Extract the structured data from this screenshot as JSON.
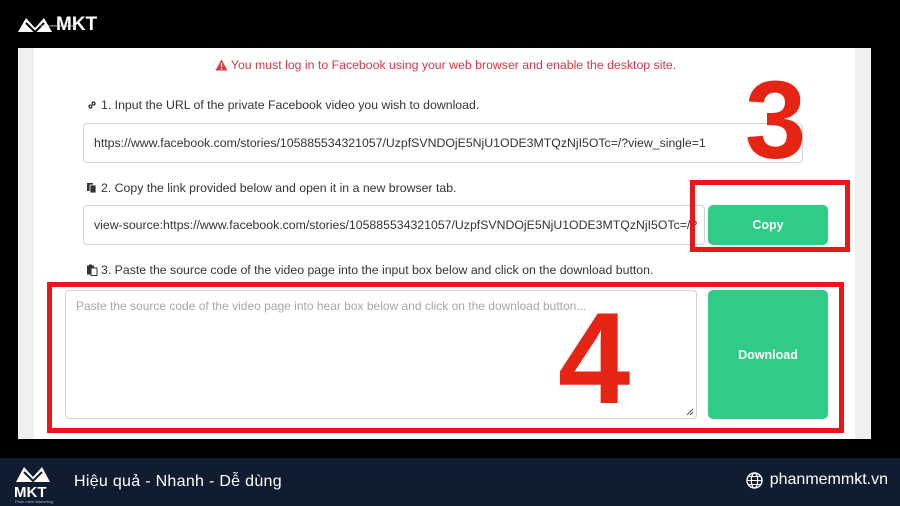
{
  "brand": {
    "name": "MKT",
    "tagline": "Phần mềm Marketing",
    "slogan": "Hiệu quả - Nhanh  - Dễ dùng",
    "website": "phanmemmkt.vn"
  },
  "alert": {
    "text": "You must log in to Facebook using your web browser and enable the desktop site.",
    "color": "#dc3545"
  },
  "steps": [
    {
      "label": "1. Input the URL of the private Facebook video you wish to download.",
      "value": "https://www.facebook.com/stories/105885534321057/UzpfSVNDOjE5NjU1ODE3MTQzNjI5OTc=/?view_single=1"
    },
    {
      "label": "2. Copy the link provided below and open it in a new browser tab.",
      "value": "view-source:https://www.facebook.com/stories/105885534321057/UzpfSVNDOjE5NjU1ODE3MTQzNjI5OTc=/?",
      "button": "Copy"
    },
    {
      "label": "3. Paste the source code of the video page into the input box below and click on the download button.",
      "placeholder": "Paste the source code of the video page into hear box below and click on the download button...",
      "button": "Download"
    }
  ],
  "annotations": {
    "step_three_number": "3",
    "step_four_number": "4",
    "highlight_color": "#e8171b"
  },
  "colors": {
    "button": "#2ecc86",
    "footer": "#101c30"
  }
}
